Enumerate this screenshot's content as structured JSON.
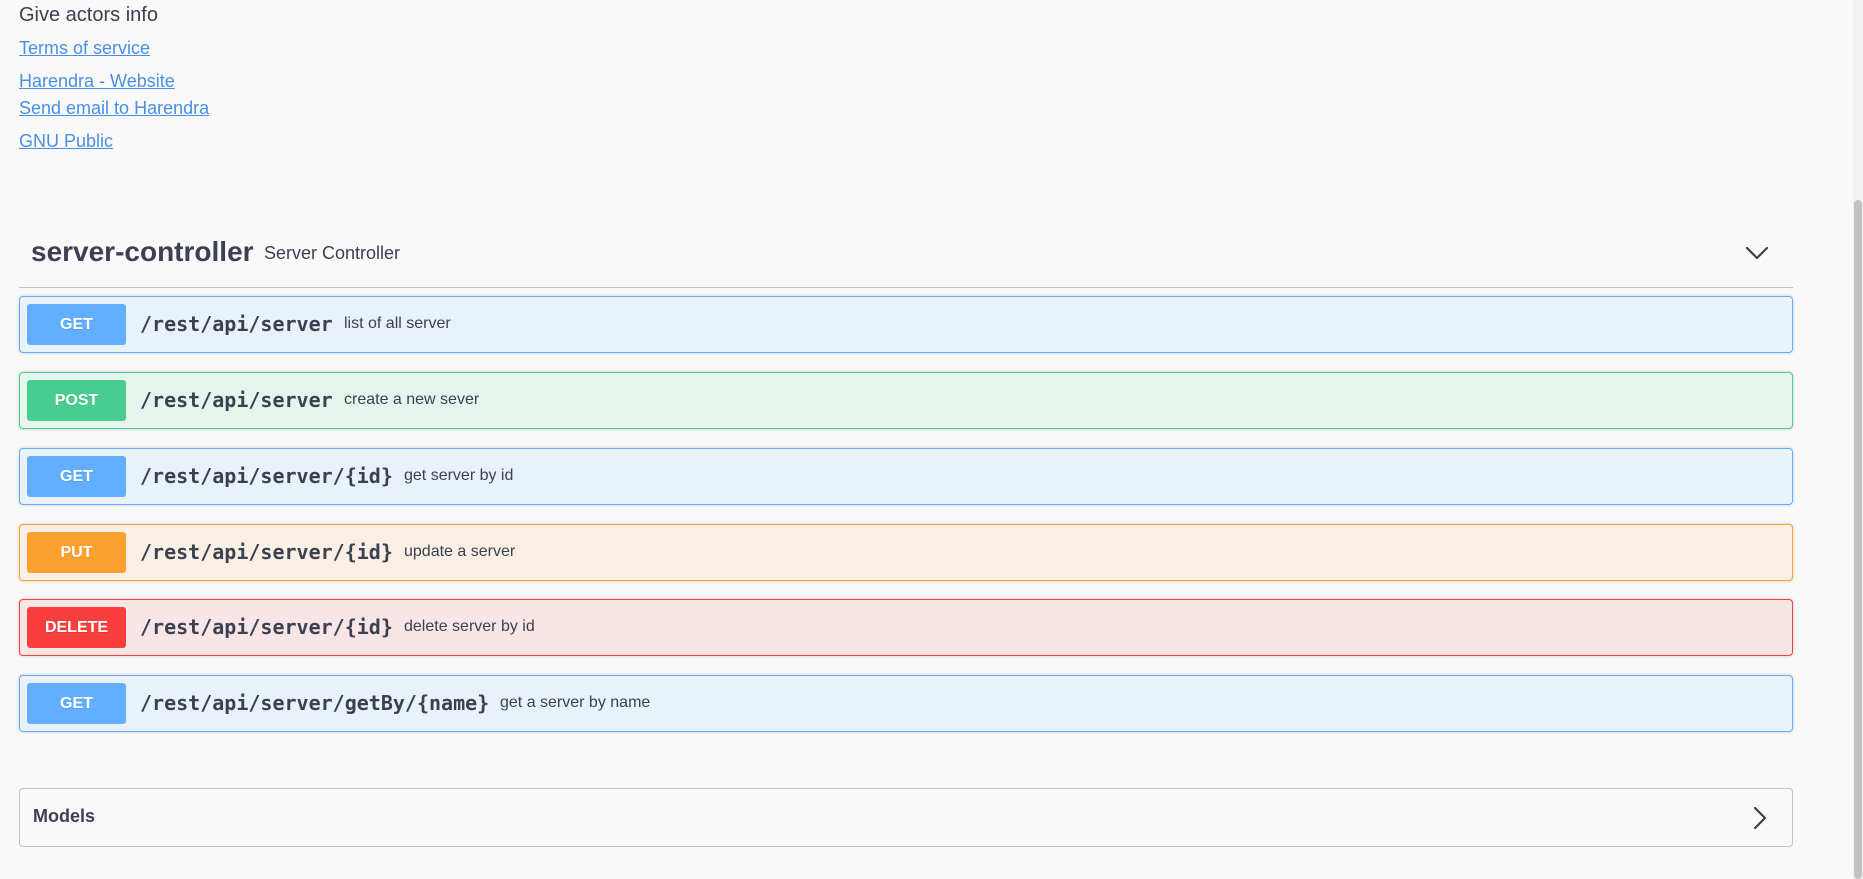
{
  "info": {
    "description": "Give actors info",
    "links": {
      "terms": "Terms of service",
      "website": "Harendra - Website",
      "email": "Send email to Harendra",
      "license": "GNU Public"
    }
  },
  "tag": {
    "name": "server-controller",
    "description": "Server Controller",
    "toggle_icon": "chevron-down-icon"
  },
  "operations": [
    {
      "method": "GET",
      "path": "/rest/api/server",
      "summary": "list of all server"
    },
    {
      "method": "POST",
      "path": "/rest/api/server",
      "summary": "create a new sever"
    },
    {
      "method": "GET",
      "path": "/rest/api/server/{id}",
      "summary": "get server by id"
    },
    {
      "method": "PUT",
      "path": "/rest/api/server/{id}",
      "summary": "update a server"
    },
    {
      "method": "DELETE",
      "path": "/rest/api/server/{id}",
      "summary": "delete server by id"
    },
    {
      "method": "GET",
      "path": "/rest/api/server/getBy/{name}",
      "summary": "get a server by name"
    }
  ],
  "models": {
    "title": "Models",
    "toggle_icon": "chevron-right-icon"
  },
  "colors": {
    "get": "#61affe",
    "post": "#49cc90",
    "put": "#fca130",
    "delete": "#f93e3e",
    "link": "#4990e2",
    "text": "#3b4151"
  }
}
